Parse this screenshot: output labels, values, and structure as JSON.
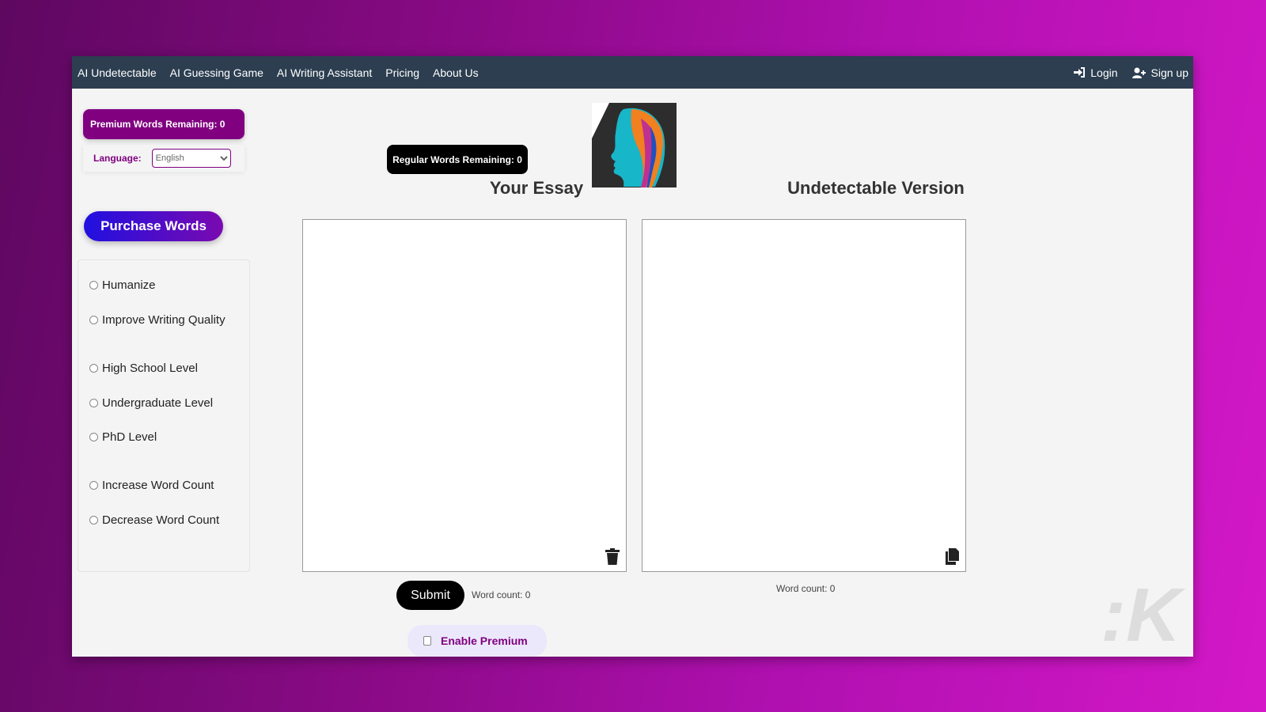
{
  "nav": {
    "items": [
      "AI Undetectable",
      "AI Guessing Game",
      "AI Writing Assistant",
      "Pricing",
      "About Us"
    ],
    "login": "Login",
    "signup": "Sign up"
  },
  "sidebar": {
    "premium_words": "Premium Words Remaining: 0",
    "language_label": "Language:",
    "language_value": "English",
    "purchase": "Purchase Words",
    "options": [
      "Humanize",
      "Improve Writing Quality",
      "High School Level",
      "Undergraduate Level",
      "PhD Level",
      "Increase Word Count",
      "Decrease Word Count"
    ]
  },
  "main": {
    "regular_words": "Regular Words Remaining: 0",
    "essay_title": "Your Essay",
    "output_title": "Undetectable Version",
    "submit": "Submit",
    "word_count_left": "Word count: 0",
    "word_count_right": "Word count: 0",
    "enable_premium": "Enable Premium"
  },
  "watermark": "K",
  "colors": {
    "nav": "#2c3e50",
    "accent": "#800080"
  }
}
